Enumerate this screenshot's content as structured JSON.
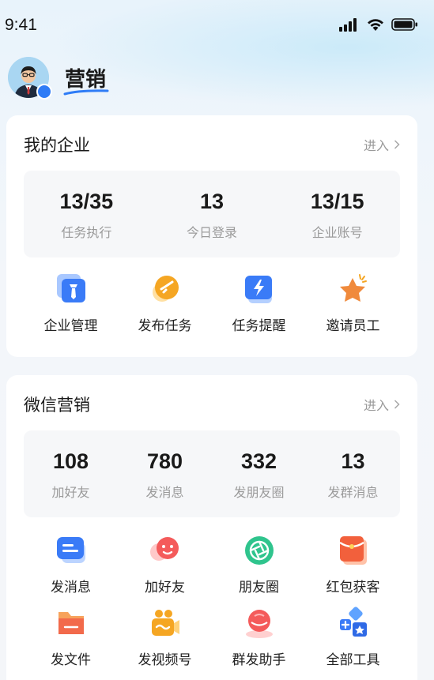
{
  "status_bar": {
    "time": "9:41"
  },
  "header": {
    "title": "营销"
  },
  "enterprise": {
    "title": "我的企业",
    "enter_label": "进入",
    "stats": [
      {
        "value": "13/35",
        "label": "任务执行"
      },
      {
        "value": "13",
        "label": "今日登录"
      },
      {
        "value": "13/15",
        "label": "企业账号"
      }
    ],
    "tools": [
      {
        "label": "企业管理",
        "icon": "enterprise-manage-icon"
      },
      {
        "label": "发布任务",
        "icon": "publish-task-icon"
      },
      {
        "label": "任务提醒",
        "icon": "task-reminder-icon"
      },
      {
        "label": "邀请员工",
        "icon": "invite-staff-icon"
      }
    ]
  },
  "wechat": {
    "title": "微信营销",
    "enter_label": "进入",
    "stats": [
      {
        "value": "108",
        "label": "加好友"
      },
      {
        "value": "780",
        "label": "发消息"
      },
      {
        "value": "332",
        "label": "发朋友圈"
      },
      {
        "value": "13",
        "label": "发群消息"
      }
    ],
    "tools": [
      {
        "label": "发消息",
        "icon": "message-icon"
      },
      {
        "label": "加好友",
        "icon": "add-friend-icon"
      },
      {
        "label": "朋友圈",
        "icon": "moments-icon"
      },
      {
        "label": "红包获客",
        "icon": "red-packet-icon"
      },
      {
        "label": "发文件",
        "icon": "file-folder-icon"
      },
      {
        "label": "发视频号",
        "icon": "video-channel-icon"
      },
      {
        "label": "群发助手",
        "icon": "group-send-icon"
      },
      {
        "label": "全部工具",
        "icon": "all-tools-icon"
      }
    ]
  }
}
